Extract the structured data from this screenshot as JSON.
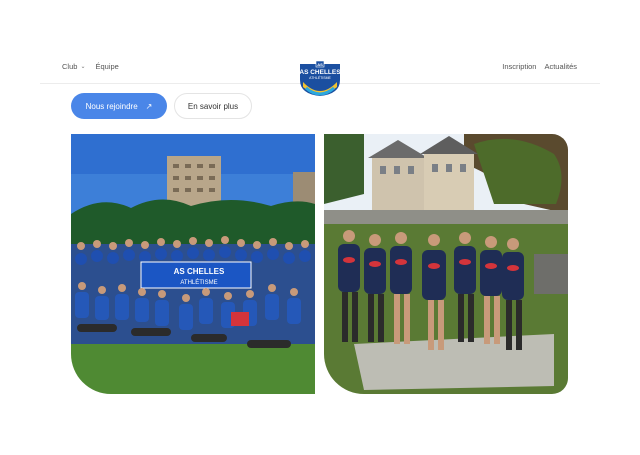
{
  "header": {
    "nav_left": [
      {
        "label": "Club",
        "has_dropdown": true
      },
      {
        "label": "Équipe",
        "has_dropdown": false
      }
    ],
    "nav_right": [
      "Inscription",
      "Actualités"
    ],
    "logo": {
      "top_text": "AS",
      "line1": "AS CHELLES",
      "line2": "ATHLÉTISME",
      "colors": [
        "#1b4fa0",
        "#f2c230",
        "#2ba8df"
      ]
    }
  },
  "cta": {
    "primary_label": "Nous rejoindre",
    "primary_icon": "arrow-up-right-icon",
    "secondary_label": "En savoir plus"
  },
  "photos": {
    "left": {
      "subject": "group-photo-blue-shirts",
      "banner_line1": "AS CHELLES",
      "banner_line2": "ATHLÉTISME"
    },
    "right": {
      "subject": "runners-group-navy-shirts"
    }
  },
  "colors": {
    "accent": "#4a86e8",
    "brand_blue": "#1b4fa0",
    "brand_yellow": "#f2c230"
  }
}
